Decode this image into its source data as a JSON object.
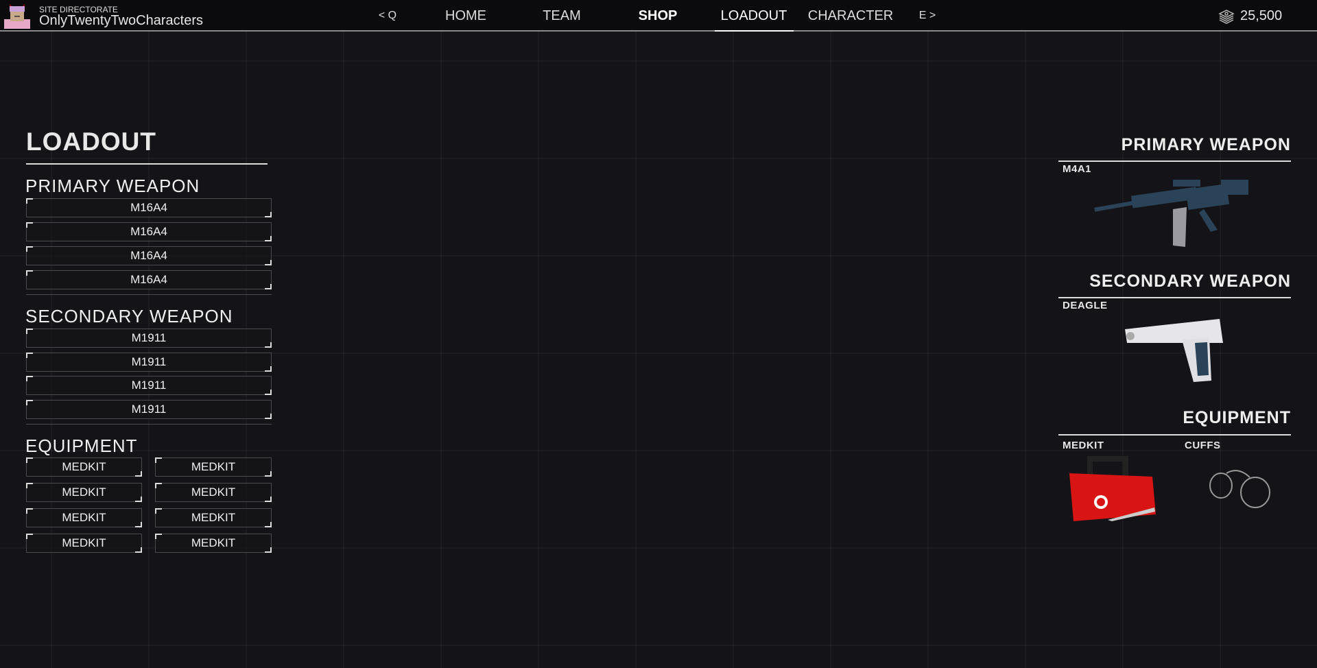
{
  "header": {
    "org": "SITE DIRECTORATE",
    "username": "OnlyTwentyTwoCharacters",
    "currency": "25,500",
    "nav": [
      {
        "label": "< Q"
      },
      {
        "label": "HOME"
      },
      {
        "label": "TEAM"
      },
      {
        "label": "SHOP"
      },
      {
        "label": "LOADOUT"
      },
      {
        "label": "CHARACTER"
      },
      {
        "label": "E >"
      }
    ],
    "active_tab": "LOADOUT"
  },
  "loadout": {
    "title": "LOADOUT",
    "primary": {
      "heading": "PRIMARY WEAPON",
      "items": [
        "M16A4",
        "M16A4",
        "M16A4",
        "M16A4"
      ]
    },
    "secondary": {
      "heading": "SECONDARY WEAPON",
      "items": [
        "M1911",
        "M1911",
        "M1911",
        "M1911"
      ]
    },
    "equipment": {
      "heading": "EQUIPMENT",
      "items": [
        "MEDKIT",
        "MEDKIT",
        "MEDKIT",
        "MEDKIT",
        "MEDKIT",
        "MEDKIT",
        "MEDKIT",
        "MEDKIT"
      ]
    }
  },
  "selected": {
    "primary_heading": "PRIMARY WEAPON",
    "primary": "M4A1",
    "secondary_heading": "SECONDARY WEAPON",
    "secondary": "DEAGLE",
    "equipment_heading": "EQUIPMENT",
    "equipment": [
      "MEDKIT",
      "CUFFS"
    ]
  },
  "colors": {
    "background": "#141418",
    "nav": "#0b0b0d",
    "rifle": "#2b4358",
    "medkit": "#d81414"
  }
}
